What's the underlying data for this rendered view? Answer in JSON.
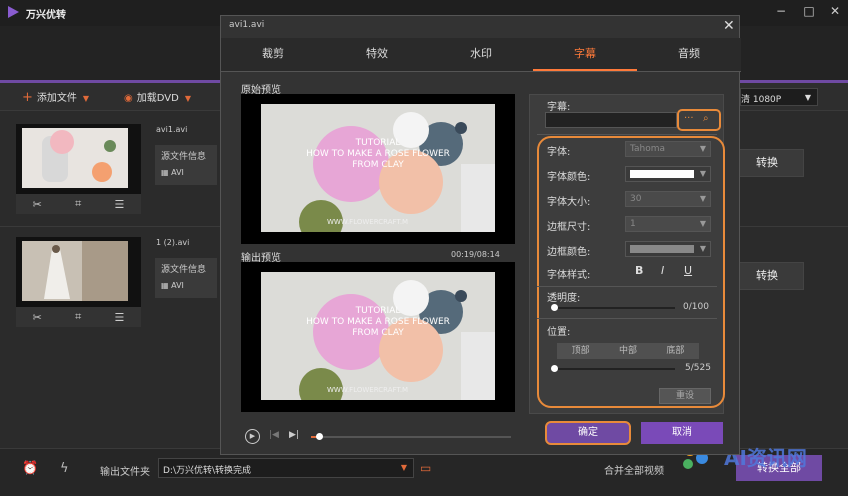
{
  "app": {
    "title": "万兴优转",
    "window_controls": [
      "−",
      "□",
      "✕"
    ]
  },
  "toolbar": {
    "add_file": "添加文件",
    "load_dvd": "加载DVD",
    "quality": "清 1080P"
  },
  "files": [
    {
      "name": "avi1.avi",
      "source_info": "源文件信息",
      "format": "AVI",
      "convert": "转换"
    },
    {
      "name": "1 (2).avi",
      "source_info": "源文件信息",
      "format": "AVI",
      "convert": "转换"
    }
  ],
  "bottom": {
    "output_label": "输出文件夹",
    "output_path": "D:\\万兴优转\\转换完成",
    "merge_label": "合并全部视频",
    "convert_all": "转换全部"
  },
  "watermark": {
    "text": "AI资讯网"
  },
  "dialog": {
    "title": "avi1.avi",
    "tabs": [
      "裁剪",
      "特效",
      "水印",
      "字幕",
      "音频"
    ],
    "active_tab": "字幕",
    "original_preview": "原始预览",
    "output_preview": "输出预览",
    "time": "00:19/08:14",
    "video_overlay": [
      "TUTORIAL",
      "HOW TO MAKE A ROSE FLOWER",
      "FROM CLAY",
      "WWW.FLOWERCRAFT.M"
    ],
    "subtitle_label": "字幕:",
    "rows": [
      {
        "label": "字体:",
        "value": "Tahoma"
      },
      {
        "label": "字体颜色:",
        "value": ""
      },
      {
        "label": "字体大小:",
        "value": "30"
      },
      {
        "label": "边框尺寸:",
        "value": "1"
      },
      {
        "label": "边框颜色:",
        "value": ""
      },
      {
        "label": "字体样式:",
        "value": ""
      }
    ],
    "font_color": "#ffffff",
    "border_color": "#888888",
    "styles": [
      "B",
      "I",
      "U"
    ],
    "opacity_label": "透明度:",
    "opacity_value": "0/100",
    "position_label": "位置:",
    "positions": [
      "顶部",
      "中部",
      "底部"
    ],
    "position_value": "5/525",
    "reset": "重设",
    "ok": "确定",
    "cancel": "取消",
    "seek_progress": 0.04
  },
  "colors": {
    "accent": "#e88a3a",
    "purple": "#6f4aa3"
  }
}
